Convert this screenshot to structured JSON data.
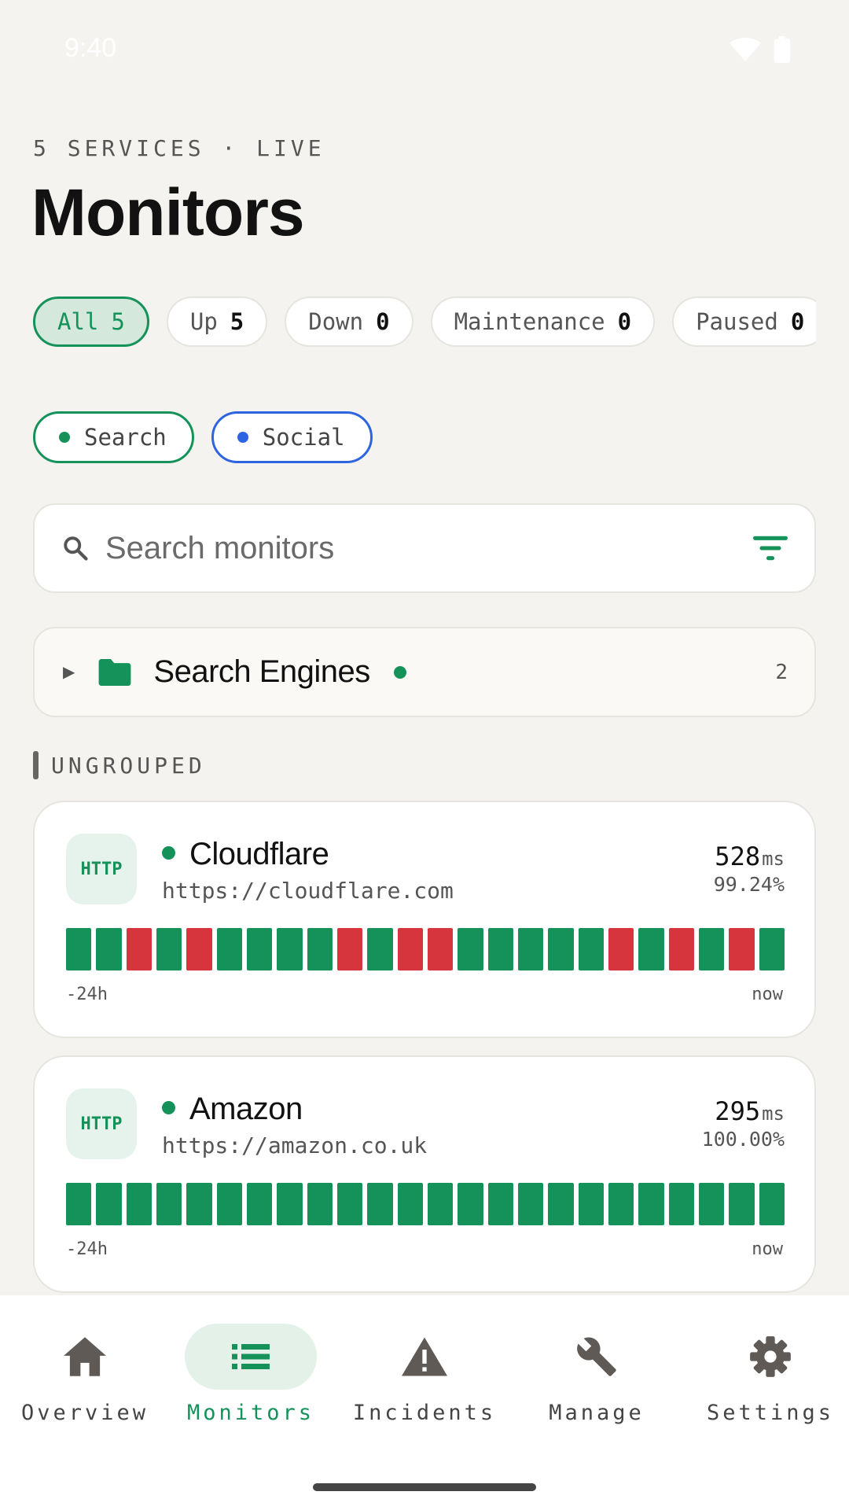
{
  "status_bar": {
    "time": "9:40"
  },
  "header": {
    "eyebrow": "5 SERVICES · LIVE",
    "title": "Monitors"
  },
  "filters": [
    {
      "label": "All",
      "count": "5",
      "active": true
    },
    {
      "label": "Up",
      "count": "5",
      "active": false
    },
    {
      "label": "Down",
      "count": "0",
      "active": false
    },
    {
      "label": "Maintenance",
      "count": "0",
      "active": false
    },
    {
      "label": "Paused",
      "count": "0",
      "active": false
    }
  ],
  "tags": [
    {
      "label": "Search",
      "color": "#14925a"
    },
    {
      "label": "Social",
      "color": "#2d64e0"
    }
  ],
  "search": {
    "placeholder": "Search monitors",
    "value": ""
  },
  "group": {
    "name": "Search Engines",
    "count": "2",
    "status_color": "#14925a"
  },
  "section": {
    "label": "UNGROUPED"
  },
  "monitors": [
    {
      "protocol": "HTTP",
      "name": "Cloudflare",
      "url": "https://cloudflare.com",
      "ms": "528",
      "ms_unit": "ms",
      "uptime": "99.24%",
      "beats": [
        "up",
        "up",
        "down",
        "up",
        "down",
        "up",
        "up",
        "up",
        "up",
        "down",
        "up",
        "down",
        "down",
        "up",
        "up",
        "up",
        "up",
        "up",
        "down",
        "up",
        "down",
        "up",
        "down",
        "up"
      ],
      "range_start": "-24h",
      "range_end": "now"
    },
    {
      "protocol": "HTTP",
      "name": "Amazon",
      "url": "https://amazon.co.uk",
      "ms": "295",
      "ms_unit": "ms",
      "uptime": "100.00%",
      "beats": [
        "up",
        "up",
        "up",
        "up",
        "up",
        "up",
        "up",
        "up",
        "up",
        "up",
        "up",
        "up",
        "up",
        "up",
        "up",
        "up",
        "up",
        "up",
        "up",
        "up",
        "up",
        "up",
        "up",
        "up"
      ],
      "range_start": "-24h",
      "range_end": "now"
    }
  ],
  "nav": {
    "items": [
      {
        "label": "Overview",
        "icon": "home-icon"
      },
      {
        "label": "Monitors",
        "icon": "list-icon",
        "active": true
      },
      {
        "label": "Incidents",
        "icon": "warning-icon"
      },
      {
        "label": "Manage",
        "icon": "wrench-icon"
      },
      {
        "label": "Settings",
        "icon": "gear-icon"
      }
    ]
  },
  "colors": {
    "accent": "#14925a",
    "down": "#d6353d",
    "background": "#f4f3ef"
  }
}
